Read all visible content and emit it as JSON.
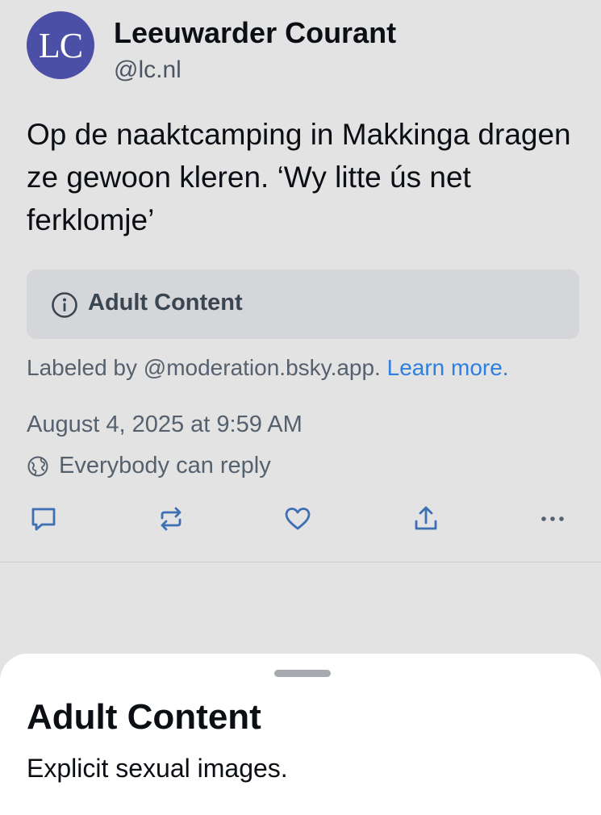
{
  "post": {
    "avatar_initials": "LC",
    "display_name": "Leeuwarder Courant",
    "handle": "@lc.nl",
    "text": "Op de naaktcamping in Makkinga dragen ze gewoon kleren. ‘Wy litte ús net ferklomje’",
    "label": {
      "icon": "info-icon",
      "title": "Adult Content"
    },
    "labeled_by_prefix": "Labeled by @moderation.bsky.app.",
    "learn_more": "Learn more.",
    "timestamp": "August 4, 2025 at 9:59 AM",
    "reply_setting": "Everybody can reply",
    "actions": [
      "reply-icon",
      "repost-icon",
      "like-icon",
      "share-icon",
      "more-icon"
    ]
  },
  "sheet": {
    "title": "Adult Content",
    "description": "Explicit sexual images."
  },
  "colors": {
    "background": "#e3e3e4",
    "avatar": "#4b4fa6",
    "link": "#2f7fe0",
    "action_icon": "#3d6fb3",
    "sheet": "#ffffff"
  }
}
